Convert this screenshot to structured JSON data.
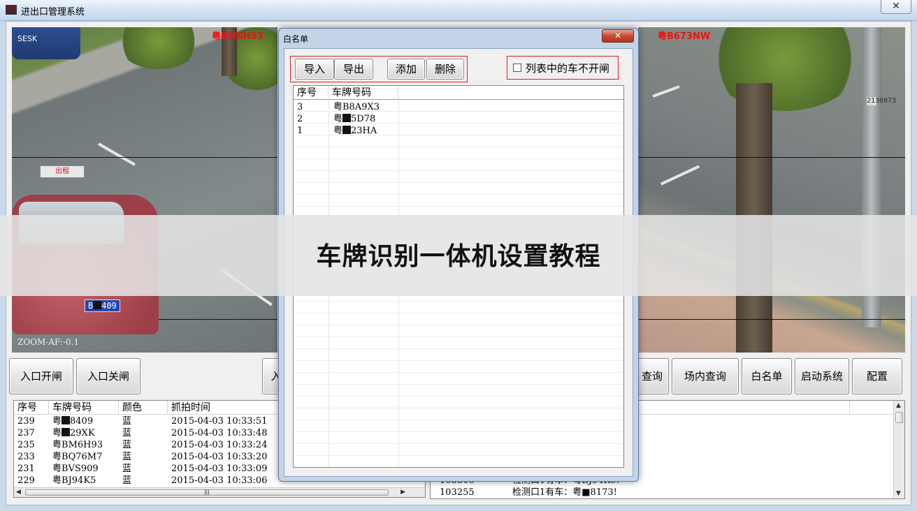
{
  "window": {
    "title": "进出口管理系统",
    "close_label": "✕"
  },
  "cameras": {
    "left": {
      "plate_overlay": "粤BM6H93",
      "zoom_text": "ZOOM-AF:-0.1",
      "car_plate_prefix": "B",
      "car_plate_suffix": "409",
      "taxi_sign": "出租",
      "sticker": "SESK"
    },
    "right": {
      "plate_overlay": "粤B673NW",
      "pole_digits": "2136073"
    }
  },
  "buttons": {
    "entry_open": "入口开闸",
    "entry_close": "入口关闸",
    "partial_left": "入",
    "query": "查询",
    "inside_query": "场内查询",
    "whitelist": "白名单",
    "start_system": "启动系统",
    "config": "配置"
  },
  "capture_list": {
    "headers": [
      "序号",
      "车牌号码",
      "颜色",
      "抓拍时间"
    ],
    "rows": [
      {
        "id": "239",
        "plate_prefix": "粤",
        "plate_suffix": "8409",
        "color": "蓝",
        "time": "2015-04-03 10:33:51"
      },
      {
        "id": "237",
        "plate_prefix": "粤",
        "plate_suffix": "29XK",
        "color": "蓝",
        "time": "2015-04-03 10:33:48"
      },
      {
        "id": "235",
        "plate_prefix": "粤",
        "plate_suffix": "BM6H93",
        "color": "蓝",
        "time": "2015-04-03 10:33:24"
      },
      {
        "id": "233",
        "plate_prefix": "粤",
        "plate_suffix": "BQ76M7",
        "color": "蓝",
        "time": "2015-04-03 10:33:20"
      },
      {
        "id": "231",
        "plate_prefix": "粤",
        "plate_suffix": "BVS909",
        "color": "蓝",
        "time": "2015-04-03 10:33:09"
      },
      {
        "id": "229",
        "plate_prefix": "粤",
        "plate_suffix": "BJ94K5",
        "color": "蓝",
        "time": "2015-04-03 10:33:06"
      }
    ]
  },
  "event_list": {
    "rows": [
      {
        "id": "103306",
        "text": "检测口1有车：粤BJ94K5!"
      },
      {
        "id": "103255",
        "text": "检测口1有车：粤■8173!"
      }
    ]
  },
  "whitelist_dialog": {
    "title": "白名单",
    "close_label": "✕",
    "import": "导入",
    "export": "导出",
    "add": "添加",
    "delete": "删除",
    "checkbox_label": "列表中的车不开闸",
    "headers": [
      "序号",
      "车牌号码"
    ],
    "rows": [
      {
        "id": "3",
        "plate": "粤B8A9X3"
      },
      {
        "id": "2",
        "plate_prefix": "粤",
        "plate_suffix": "5D78"
      },
      {
        "id": "1",
        "plate_prefix": "粤",
        "plate_suffix": "23HA"
      }
    ]
  },
  "banner": {
    "text": "车牌识别一体机设置教程"
  },
  "colors": {
    "title_bar": "#d4e2f3",
    "dialog_frame": "#c3d4e9",
    "highlight_box": "#e02020",
    "close_button": "#c74a33"
  }
}
